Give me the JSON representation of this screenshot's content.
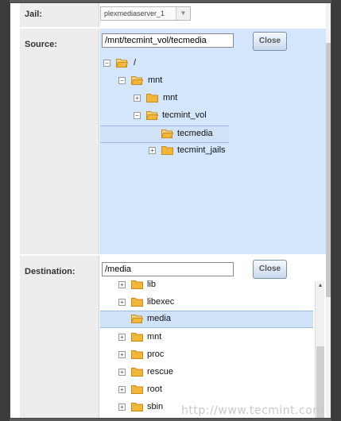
{
  "jail": {
    "label": "Jail:",
    "value": "plexmediaserver_1"
  },
  "source": {
    "label": "Source:",
    "path": "/mnt/tecmint_vol/tecmedia",
    "close_label": "Close",
    "tree": [
      {
        "label": "/",
        "expander": "−",
        "selected": false
      },
      {
        "label": "mnt",
        "expander": "−",
        "selected": false
      },
      {
        "label": "mnt",
        "expander": "+",
        "selected": false
      },
      {
        "label": "tecmint_vol",
        "expander": "−",
        "selected": false
      },
      {
        "label": "tecmedia",
        "expander": "",
        "selected": true
      },
      {
        "label": "tecmint_jails",
        "expander": "+",
        "selected": false
      }
    ]
  },
  "destination": {
    "label": "Destination:",
    "path": "/media",
    "close_label": "Close",
    "tree": [
      {
        "label": "lib",
        "expander": "+",
        "selected": false
      },
      {
        "label": "libexec",
        "expander": "+",
        "selected": false
      },
      {
        "label": "media",
        "expander": "",
        "selected": true
      },
      {
        "label": "mnt",
        "expander": "+",
        "selected": false
      },
      {
        "label": "proc",
        "expander": "+",
        "selected": false
      },
      {
        "label": "rescue",
        "expander": "+",
        "selected": false
      },
      {
        "label": "root",
        "expander": "+",
        "selected": false
      },
      {
        "label": "sbin",
        "expander": "+",
        "selected": false
      }
    ]
  },
  "watermark": "http://www.tecmint.com",
  "colors": {
    "folder": "#f2b63a",
    "selection": "#cfe2f8",
    "source_bg": "#d4e6fb"
  }
}
